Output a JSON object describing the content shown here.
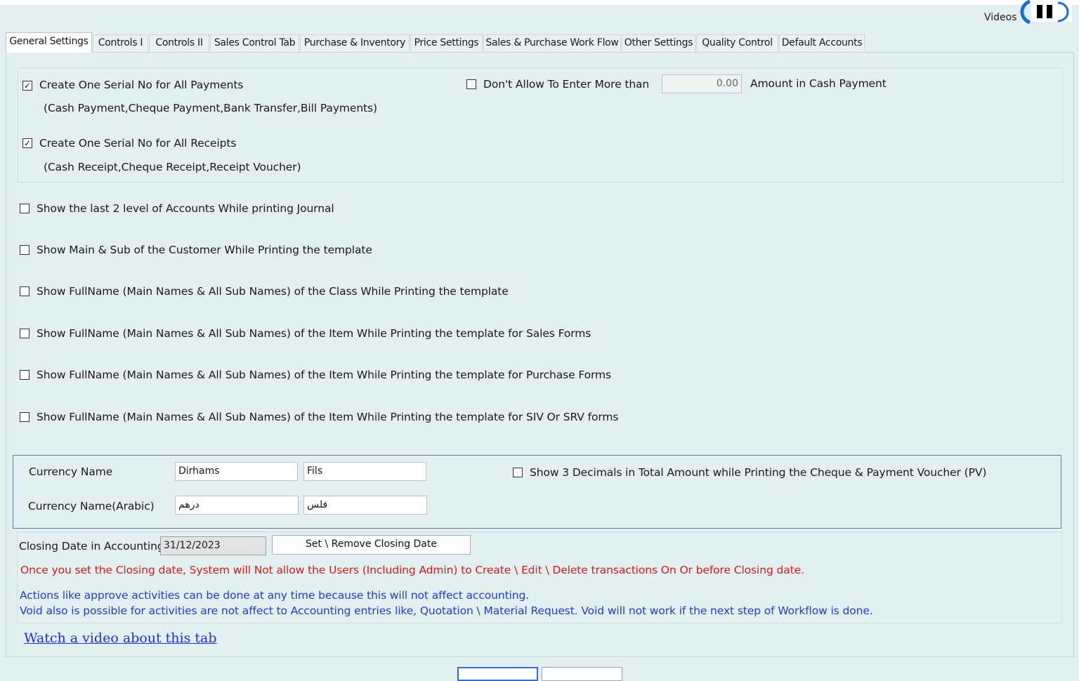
{
  "header": {
    "videos_label": "Videos"
  },
  "tabs": [
    {
      "label": "General Settings"
    },
    {
      "label": "Controls I"
    },
    {
      "label": "Controls II"
    },
    {
      "label": "Sales Control Tab"
    },
    {
      "label": "Purchase & Inventory"
    },
    {
      "label": "Price Settings"
    },
    {
      "label": "Sales & Purchase Work Flow"
    },
    {
      "label": "Other Settings"
    },
    {
      "label": "Quality Control"
    },
    {
      "label": "Default Accounts"
    }
  ],
  "serials": {
    "payments_label": "Create One Serial No for All Payments",
    "payments_note": "(Cash Payment,Cheque Payment,Bank Transfer,Bill Payments)",
    "payments_checked": true,
    "receipts_label": "Create One Serial No for All Receipts",
    "receipts_note": "(Cash Receipt,Cheque Receipt,Receipt Voucher)",
    "receipts_checked": true,
    "cash_limit_label": "Don't Allow To Enter More than",
    "cash_limit_value": "0.00",
    "cash_limit_suffix": "Amount in Cash Payment",
    "cash_limit_checked": false
  },
  "options": [
    {
      "label": "Show the last 2 level of Accounts While printing Journal",
      "checked": false
    },
    {
      "label": "Show Main & Sub of the Customer While Printing the template",
      "checked": false
    },
    {
      "label": "Show FullName (Main Names & All Sub Names) of the Class While Printing the template",
      "checked": false
    },
    {
      "label": "Show FullName (Main Names & All Sub Names) of the Item While Printing the template for Sales Forms",
      "checked": false
    },
    {
      "label": "Show FullName (Main Names & All Sub Names) of the Item While Printing the template for Purchase Forms",
      "checked": false
    },
    {
      "label": "Show FullName (Main Names & All Sub Names) of the Item While Printing the template for SIV Or SRV forms",
      "checked": false
    }
  ],
  "currency": {
    "name_label": "Currency Name",
    "name_main": "Dirhams",
    "name_sub": "Fils",
    "arabic_label": "Currency Name(Arabic)",
    "arabic_main": "درهم",
    "arabic_sub": "فلس",
    "decimals_label": "Show 3 Decimals in Total Amount while Printing the Cheque & Payment Voucher (PV)",
    "decimals_checked": false
  },
  "closing": {
    "label": "Closing Date in Accounting",
    "date": "31/12/2023",
    "button": "Set \\ Remove Closing Date",
    "warning": "Once you set the Closing date, System will Not allow the Users (Including Admin)  to Create \\ Edit \\ Delete transactions On Or before Closing date.",
    "info1": "Actions like approve activities can be done at any time because this will not affect accounting.",
    "info2": "Void also is possible for activities are not affect to Accounting entries like, Quotation \\ Material Request. Void will not work if the next step of Workflow is done."
  },
  "video_link": "Watch a video about this tab",
  "colors": {
    "warning": "#d61a1a",
    "info": "#1d3fd0",
    "link": "#1a33d6",
    "background": "#e4eff2"
  }
}
